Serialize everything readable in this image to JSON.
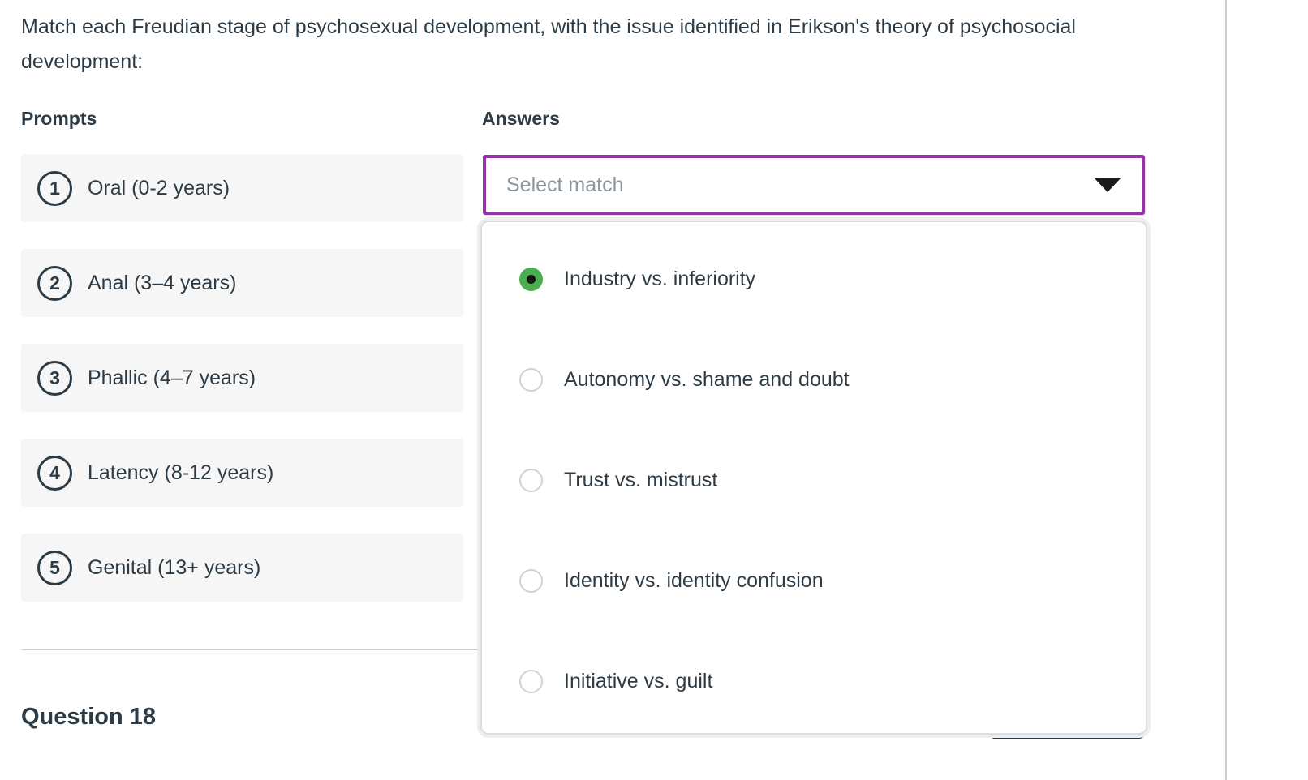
{
  "question": {
    "stem_parts": [
      {
        "text": "Match each ",
        "underlined": false
      },
      {
        "text": "Freudian",
        "underlined": true
      },
      {
        "text": " stage of ",
        "underlined": false
      },
      {
        "text": "psychosexual",
        "underlined": true
      },
      {
        "text": " development, with the issue identified in ",
        "underlined": false
      },
      {
        "text": "Erikson's",
        "underlined": true
      },
      {
        "text": " theory of ",
        "underlined": false
      },
      {
        "text": "psychosocial",
        "underlined": true
      },
      {
        "text": " development:",
        "underlined": false
      }
    ]
  },
  "columns": {
    "prompts_heading": "Prompts",
    "answers_heading": "Answers"
  },
  "prompts": [
    {
      "number": "1",
      "label": "Oral (0-2 years)"
    },
    {
      "number": "2",
      "label": "Anal (3–4 years)"
    },
    {
      "number": "3",
      "label": "Phallic (4–7 years)"
    },
    {
      "number": "4",
      "label": "Latency (8-12 years)"
    },
    {
      "number": "5",
      "label": "Genital (13+ years)"
    }
  ],
  "select": {
    "placeholder": "Select match",
    "value": "",
    "caret_icon": "chevron-down-icon",
    "focus_color": "#9234a8",
    "open": true
  },
  "options": [
    {
      "label": "Industry vs. inferiority",
      "selected": true
    },
    {
      "label": "Autonomy vs. shame and doubt",
      "selected": false
    },
    {
      "label": "Trust vs. mistrust",
      "selected": false
    },
    {
      "label": "Identity vs. identity confusion",
      "selected": false
    },
    {
      "label": "Initiative vs. guilt",
      "selected": false
    }
  ],
  "next_section": {
    "heading": "Question 18"
  },
  "colors": {
    "accent_purple": "#9234a8",
    "selected_green": "#4cae50",
    "row_background": "#f6f6f6",
    "text": "#2d3b45",
    "muted_text": "#8b959e",
    "border": "#c7cdd1"
  }
}
